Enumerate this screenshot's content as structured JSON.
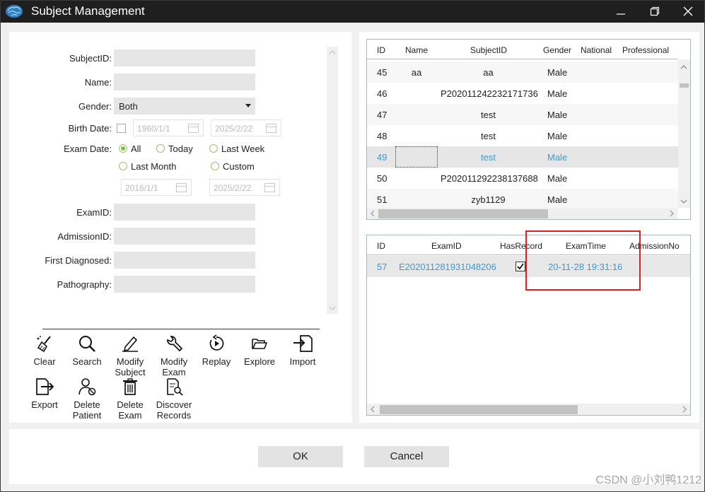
{
  "window": {
    "title": "Subject Management",
    "accent_color": "#3d9ad1"
  },
  "form": {
    "subject_id_label": "SubjectID:",
    "subject_id_value": "",
    "name_label": "Name:",
    "name_value": "",
    "gender_label": "Gender:",
    "gender_selected": "Both",
    "birth_date_label": "Birth Date:",
    "birth_from": "1960/1/1",
    "birth_to": "2025/2/22",
    "exam_date_label": "Exam Date:",
    "exam_options": [
      "All",
      "Today",
      "Last Week",
      "Last Month",
      "Custom"
    ],
    "exam_selected": "All",
    "exam_from": "2016/1/1",
    "exam_to": "2025/2/22",
    "exam_id_label": "ExamID:",
    "admission_id_label": "AdmissionID:",
    "first_diagnosed_label": "First Diagnosed:",
    "pathography_label": "Pathography:"
  },
  "toolbar": {
    "clear": "Clear",
    "search": "Search",
    "modify_subject": "Modify Subject",
    "modify_exam": "Modify Exam",
    "replay": "Replay",
    "explore": "Explore",
    "import": "Import",
    "export": "Export",
    "delete_patient": "Delete Patient",
    "delete_exam": "Delete Exam",
    "discover_records": "Discover Records"
  },
  "subjects_table": {
    "columns": [
      "ID",
      "Name",
      "SubjectID",
      "Gender",
      "National",
      "Professional"
    ],
    "rows": [
      {
        "id": "45",
        "name": "aa",
        "subject_id": "aa",
        "gender": "Male"
      },
      {
        "id": "46",
        "name": "",
        "subject_id": "P202011242232171736",
        "gender": "Male"
      },
      {
        "id": "47",
        "name": "",
        "subject_id": "test",
        "gender": "Male"
      },
      {
        "id": "48",
        "name": "",
        "subject_id": "test",
        "gender": "Male"
      },
      {
        "id": "49",
        "name": "",
        "subject_id": "test",
        "gender": "Male",
        "selected": true
      },
      {
        "id": "50",
        "name": "",
        "subject_id": "P202011292238137688",
        "gender": "Male"
      },
      {
        "id": "51",
        "name": "",
        "subject_id": "zyb1129",
        "gender": "Male"
      }
    ]
  },
  "exams_table": {
    "columns": [
      "ID",
      "ExamID",
      "HasRecord",
      "ExamTime",
      "AdmissionNo"
    ],
    "rows": [
      {
        "id": "57",
        "exam_id": "E202011281931048206",
        "has_record": true,
        "exam_time": "20-11-28 19:31:16"
      }
    ]
  },
  "dialog": {
    "ok": "OK",
    "cancel": "Cancel"
  },
  "watermark": "CSDN @小刘鸭1212"
}
